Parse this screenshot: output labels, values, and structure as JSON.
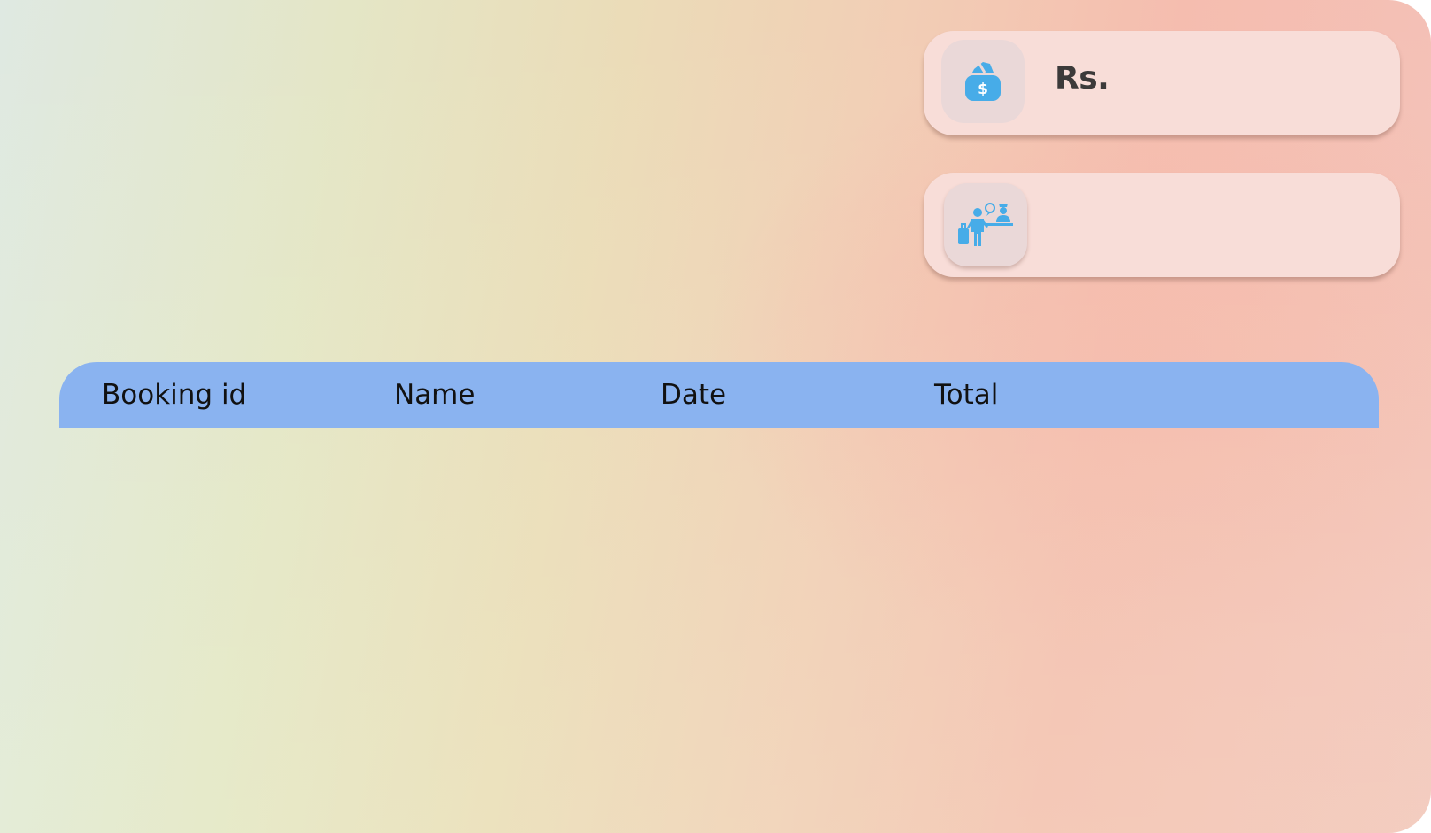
{
  "stats": {
    "revenue": {
      "icon": "money-bag-icon",
      "value": "Rs."
    },
    "checkins": {
      "icon": "hotel-reception-icon",
      "value": ""
    }
  },
  "bookings_table": {
    "columns": [
      "Booking id",
      "Name",
      "Date",
      "Total"
    ],
    "rows": []
  },
  "colors": {
    "header_bg": "#8ab3f0",
    "card_bg": "#f8ddd8",
    "icon_color": "#47ace8"
  }
}
